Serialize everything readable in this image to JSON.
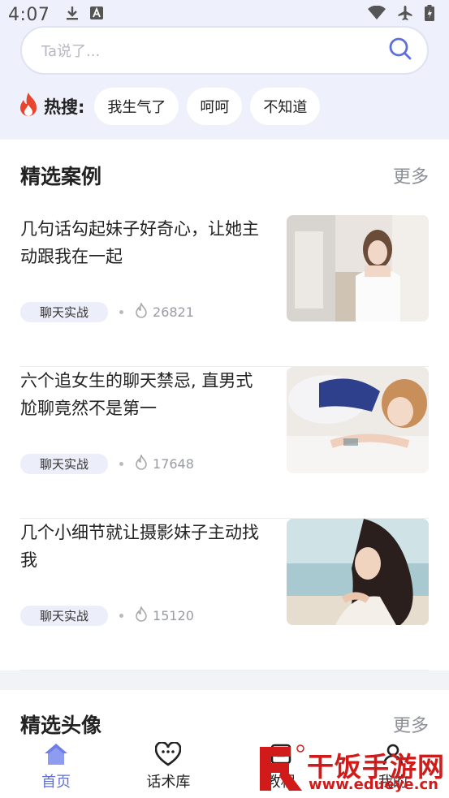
{
  "status": {
    "time": "4:07"
  },
  "search": {
    "placeholder": "Ta说了..."
  },
  "hot": {
    "label": "热搜:",
    "chips": [
      "我生气了",
      "呵呵",
      "不知道"
    ]
  },
  "featured_cases": {
    "title": "精选案例",
    "more": "更多",
    "articles": [
      {
        "title": "几句话勾起妹子好奇心，让她主动跟我在一起",
        "tag": "聊天实战",
        "count": "26821"
      },
      {
        "title": "六个追女生的聊天禁忌, 直男式尬聊竟然不是第一",
        "tag": "聊天实战",
        "count": "17648"
      },
      {
        "title": "几个小细节就让摄影妹子主动找我",
        "tag": "聊天实战",
        "count": "15120"
      }
    ]
  },
  "featured_avatars": {
    "title": "精选头像",
    "more": "更多"
  },
  "nav": {
    "items": [
      {
        "label": "首页",
        "icon": "home-icon",
        "active": true
      },
      {
        "label": "话术库",
        "icon": "heart-chat-icon",
        "active": false
      },
      {
        "label": "教程",
        "icon": "book-icon",
        "active": false
      },
      {
        "label": "我的",
        "icon": "profile-icon",
        "active": false
      }
    ]
  },
  "watermark": {
    "text": "干饭手游网",
    "url": "www.edueye.cn"
  },
  "colors": {
    "accent": "#5e6fd8",
    "hot": "#e8452f",
    "watermark": "#d11b1b"
  }
}
